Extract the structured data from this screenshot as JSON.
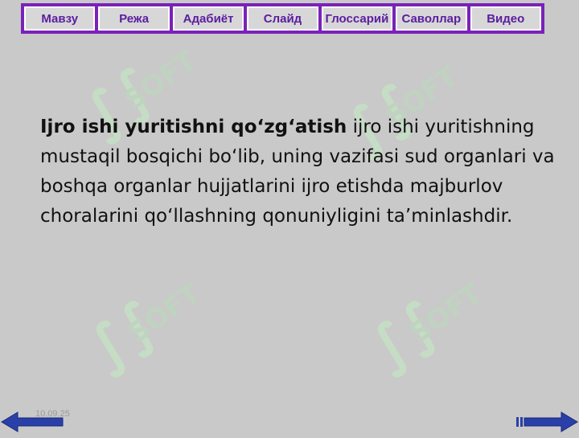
{
  "nav": {
    "items": [
      "Мавзу",
      "Режа",
      "Адабиёт",
      "Слайд",
      "Глоссарий",
      "Саволлар",
      "Видео"
    ]
  },
  "content": {
    "term": "Ijro ishi yuritishni qo‘zg‘atish",
    "definition": " ijro ishi yuritishning mustaqil bosqichi bo‘lib, uning vazifasi sud organlari va boshqa organlar hujjatlarini ijro etishda majburlov choralarini qo‘llashning qonuniyligini ta’minlashdir."
  },
  "footer": {
    "date": "10.09.25"
  },
  "watermark": {
    "text": "SOFT"
  },
  "colors": {
    "nav_frame": "#7a22b8",
    "nav_text": "#5b1da0",
    "arrow": "#2a3fa8"
  },
  "icons": {
    "prev": "arrow-left-icon",
    "next": "arrow-right-icon"
  }
}
